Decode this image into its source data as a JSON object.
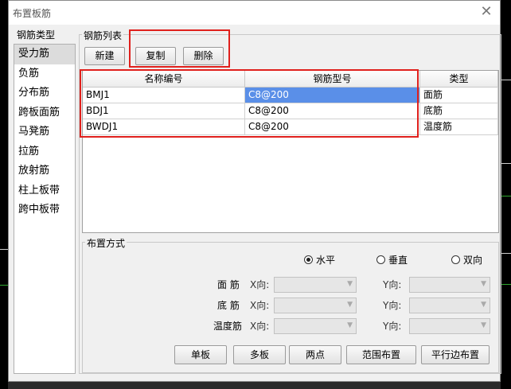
{
  "window": {
    "title": "布置板筋"
  },
  "icons": {
    "close": "close-icon",
    "dropdown": "chevron-down-icon"
  },
  "colors": {
    "highlight": "#5a8fe8",
    "annotation": "#e0201c"
  },
  "types": {
    "label": "钢筋类型",
    "items": [
      "受力筋",
      "负筋",
      "分布筋",
      "跨板面筋",
      "马凳筋",
      "拉筋",
      "放射筋",
      "柱上板带",
      "跨中板带"
    ],
    "selected": "受力筋"
  },
  "list": {
    "label": "钢筋列表",
    "buttons": {
      "new": "新建",
      "copy": "复制",
      "delete": "删除"
    },
    "columns": [
      "名称编号",
      "钢筋型号",
      "类型"
    ],
    "rows": [
      {
        "name": "BMJ1",
        "spec": "C8@200",
        "type": "面筋"
      },
      {
        "name": "BDJ1",
        "spec": "C8@200",
        "type": "底筋"
      },
      {
        "name": "BWDJ1",
        "spec": "C8@200",
        "type": "温度筋"
      }
    ]
  },
  "layout_section": {
    "label": "布置方式",
    "direction_options": [
      "水平",
      "垂直",
      "双向"
    ],
    "selected_direction": "水平",
    "rows": [
      {
        "label": "面 筋",
        "x": "X向:",
        "y": "Y向:"
      },
      {
        "label": "底 筋",
        "x": "X向:",
        "y": "Y向:"
      },
      {
        "label": "温度筋",
        "x": "X向:",
        "y": "Y向:"
      }
    ],
    "buttons": [
      "单板",
      "多板",
      "两点",
      "范围布置",
      "平行边布置"
    ]
  }
}
